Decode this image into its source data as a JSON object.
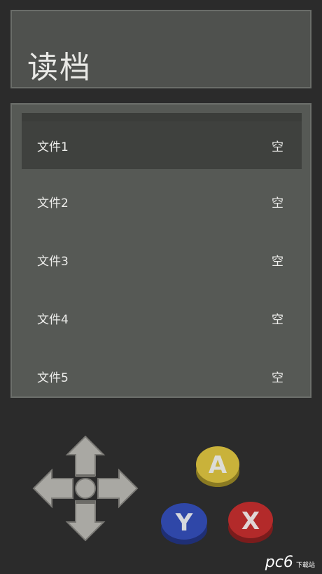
{
  "header": {
    "title": "读档"
  },
  "save_slots": [
    {
      "name": "文件1",
      "status": "空",
      "selected": true
    },
    {
      "name": "文件2",
      "status": "空",
      "selected": false
    },
    {
      "name": "文件3",
      "status": "空",
      "selected": false
    },
    {
      "name": "文件4",
      "status": "空",
      "selected": false
    },
    {
      "name": "文件5",
      "status": "空",
      "selected": false
    }
  ],
  "controller": {
    "dpad_icon": "dpad-icon",
    "buttons": [
      {
        "label": "A",
        "color": "#c9b23a"
      },
      {
        "label": "Y",
        "color": "#2f47a8"
      },
      {
        "label": "X",
        "color": "#b32a2a"
      }
    ]
  },
  "watermark": {
    "text": "pc6",
    "sub": "下载站"
  }
}
